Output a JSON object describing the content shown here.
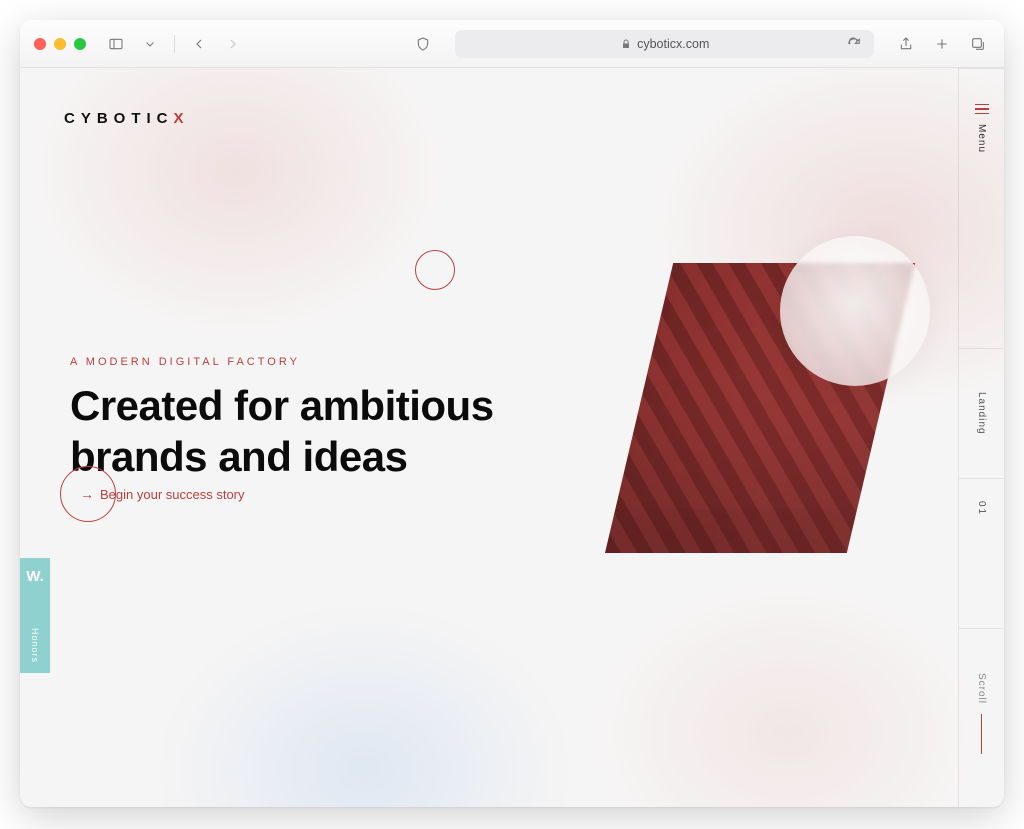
{
  "browser": {
    "url_display": "cyboticx.com"
  },
  "site": {
    "logo_letters": "CYBOTIC",
    "logo_x": "X",
    "eyebrow": "A MODERN DIGITAL FACTORY",
    "headline_line1": "Created for ambitious",
    "headline_line2": "brands and ideas",
    "cta_label": "Begin your success story",
    "rail": {
      "menu_label": "Menu",
      "section_label": "Landing",
      "section_index": "01",
      "scroll_label": "Scroll"
    },
    "honors": {
      "badge": "W.",
      "label": "Honors"
    }
  }
}
